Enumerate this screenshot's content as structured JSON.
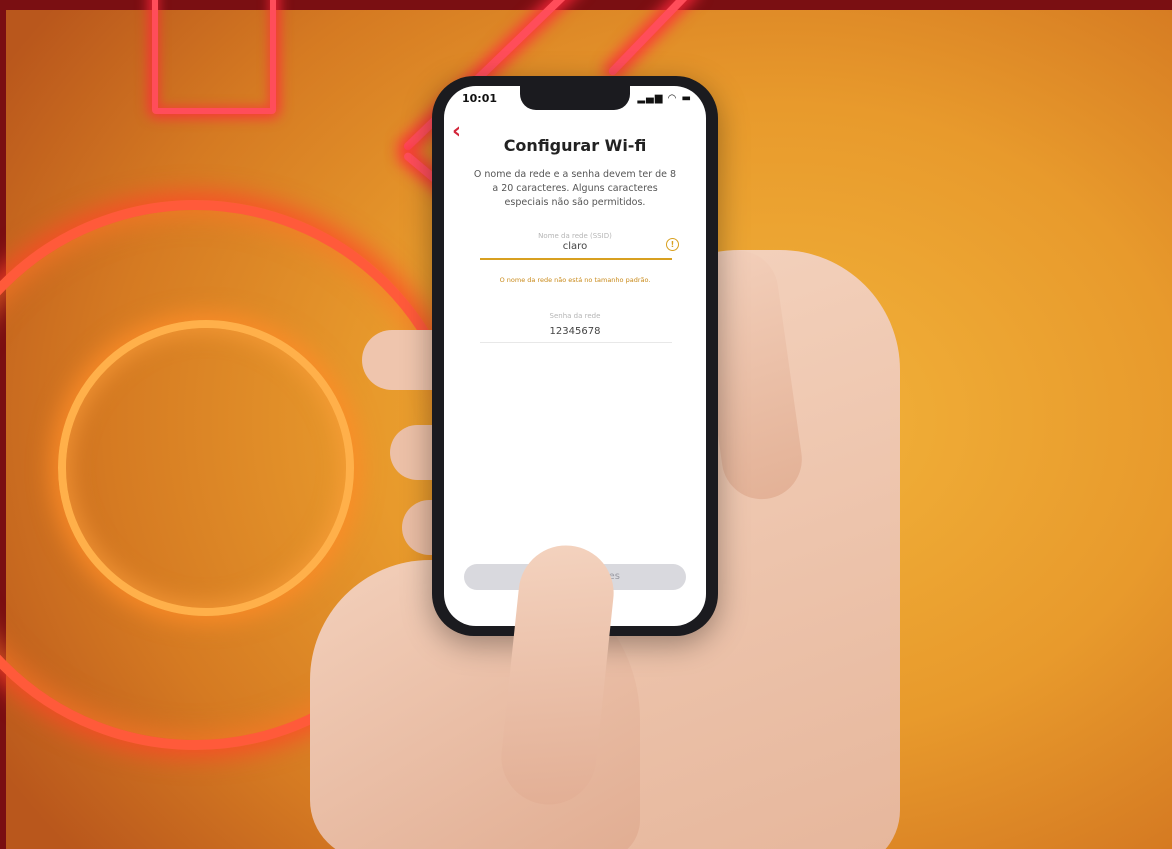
{
  "status_bar": {
    "time": "10:01",
    "signal_icon": "signal-bars-icon",
    "wifi_icon": "wifi-icon",
    "battery_icon": "battery-icon"
  },
  "screen": {
    "back_icon": "chevron-left-icon",
    "title": "Configurar Wi-fi",
    "description": "O nome da rede e a senha devem ter de 8 a 20 caracteres. Alguns caracteres especiais não são permitidos.",
    "network_name": {
      "label": "Nome da rede (SSID)",
      "value": "claro",
      "status_icon": "warning-circle-icon"
    },
    "error_message": "O nome da rede não está no tamanho padrão.",
    "network_password": {
      "label": "Senha da rede",
      "value": "12345678"
    },
    "apply_button_label": "Aplicar alterações"
  },
  "colors": {
    "accent": "#d3263a",
    "warning": "#d8a020",
    "background_orange": "#e89a2c",
    "neon_red": "#ff4d5a"
  }
}
